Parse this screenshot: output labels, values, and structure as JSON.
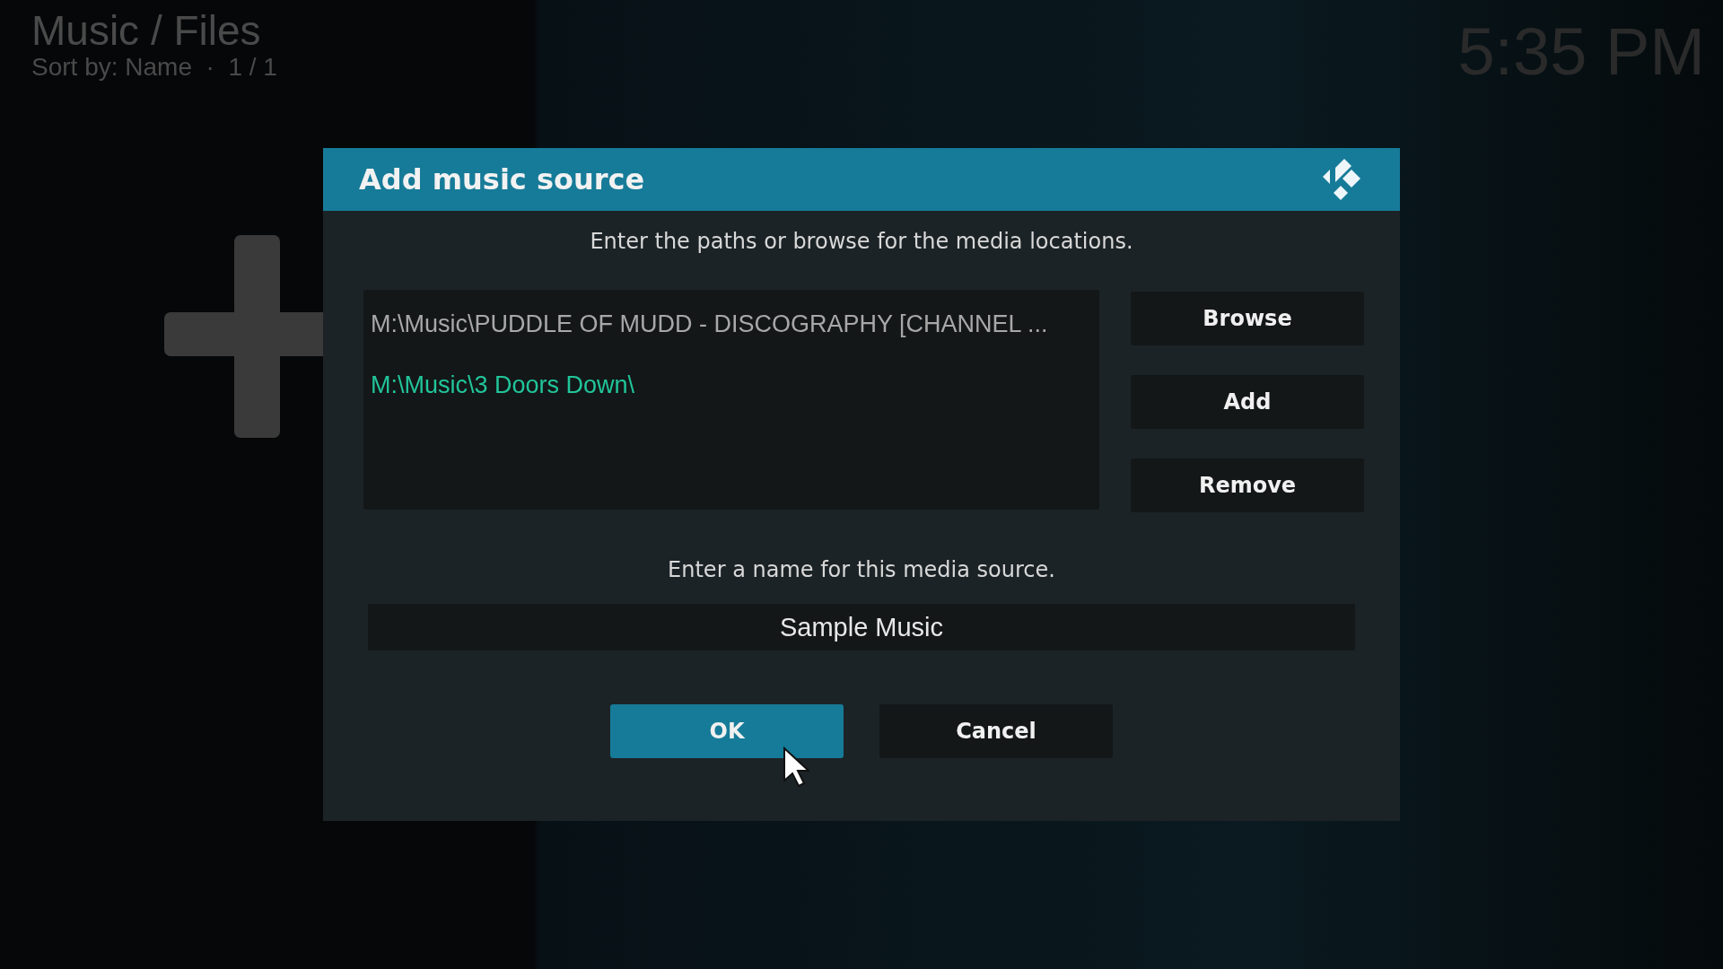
{
  "header": {
    "title": "Music / Files",
    "subtitle": "Sort by: Name  ·  1 / 1",
    "clock": "5:35 PM"
  },
  "dialog": {
    "title": "Add music source",
    "paths_prompt": "Enter the paths or browse for the media locations.",
    "paths": [
      {
        "text": "M:\\Music\\PUDDLE OF MUDD - DISCOGRAPHY [CHANNEL ...",
        "selected": false
      },
      {
        "text": "M:\\Music\\3 Doors Down\\",
        "selected": true
      }
    ],
    "side_buttons": [
      {
        "label": "Browse",
        "focused": false
      },
      {
        "label": "Add",
        "focused": false
      },
      {
        "label": "Remove",
        "focused": false
      }
    ],
    "name_prompt": "Enter a name for this media source.",
    "name_value": "Sample Music",
    "buttons": [
      {
        "label": "OK",
        "focused": true
      },
      {
        "label": "Cancel",
        "focused": false
      }
    ]
  }
}
